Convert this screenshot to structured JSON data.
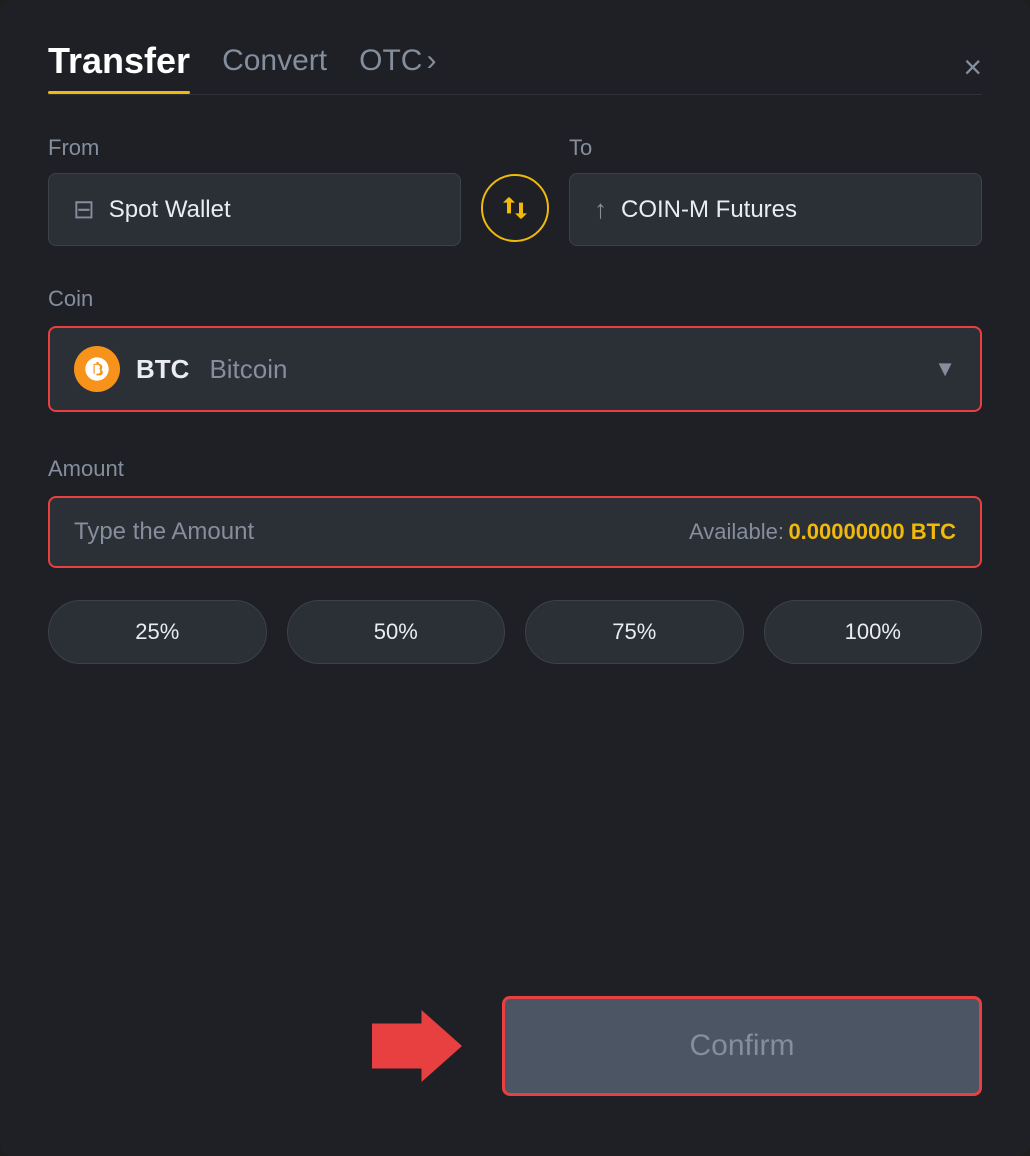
{
  "header": {
    "tab_transfer": "Transfer",
    "tab_convert": "Convert",
    "tab_otc": "OTC",
    "otc_chevron": "›",
    "close_label": "×"
  },
  "from_section": {
    "label": "From",
    "wallet_name": "Spot Wallet"
  },
  "to_section": {
    "label": "To",
    "wallet_name": "COIN-M Futures"
  },
  "coin_section": {
    "label": "Coin",
    "coin_symbol": "BTC",
    "coin_full_name": "Bitcoin",
    "dropdown_icon": "▼"
  },
  "amount_section": {
    "label": "Amount",
    "placeholder": "Type the Amount",
    "available_label": "Available:",
    "available_amount": "0.00000000 BTC"
  },
  "pct_buttons": [
    "25%",
    "50%",
    "75%",
    "100%"
  ],
  "confirm_button": {
    "label": "Confirm"
  },
  "colors": {
    "accent_yellow": "#f0b90b",
    "accent_red": "#e84040",
    "bg_dark": "#1e2026",
    "text_primary": "#eaecef",
    "text_secondary": "#848e9c"
  }
}
